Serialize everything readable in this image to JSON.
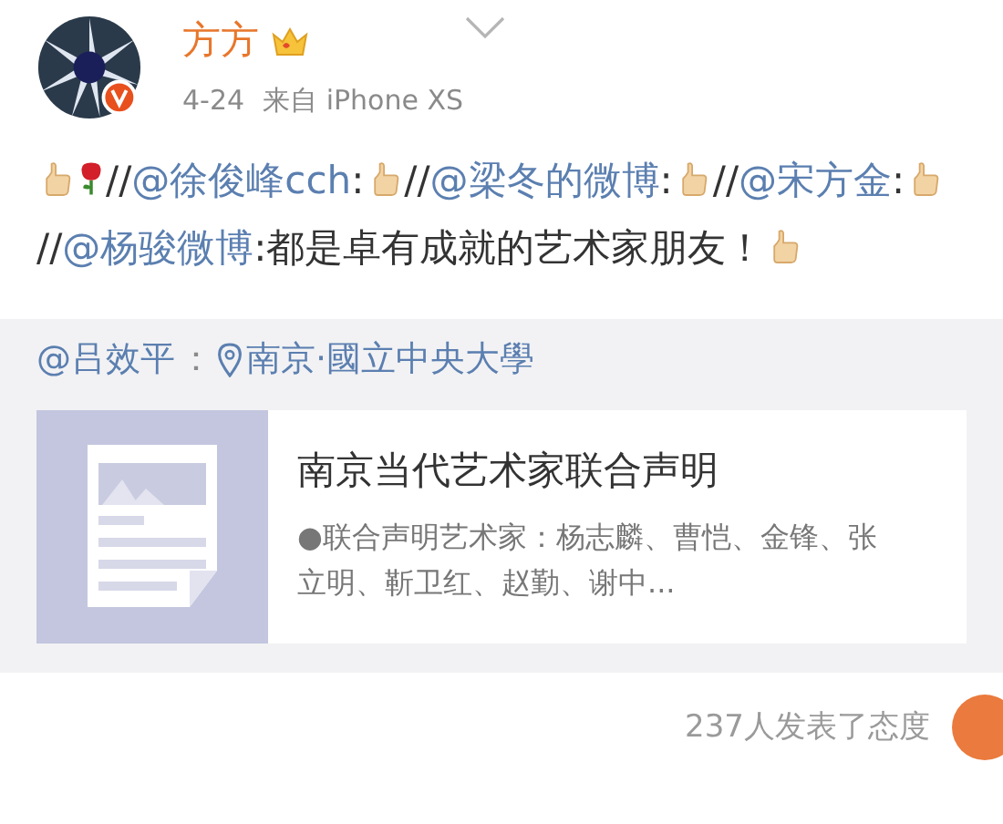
{
  "post": {
    "author": "方方",
    "time": "4-24",
    "source": "来自 iPhone XS",
    "body": [
      {
        "kind": "thumb"
      },
      {
        "kind": "rose"
      },
      {
        "kind": "text",
        "text": "//"
      },
      {
        "kind": "mention",
        "text": "@徐俊峰cch"
      },
      {
        "kind": "text",
        "text": ":"
      },
      {
        "kind": "thumb"
      },
      {
        "kind": "text",
        "text": "//"
      },
      {
        "kind": "mention",
        "text": "@梁冬的微博"
      },
      {
        "kind": "text",
        "text": ":"
      },
      {
        "kind": "thumb"
      },
      {
        "kind": "text",
        "text": "//"
      },
      {
        "kind": "mention",
        "text": "@宋方金"
      },
      {
        "kind": "text",
        "text": ":"
      },
      {
        "kind": "thumb"
      },
      {
        "kind": "text",
        "text": "//"
      },
      {
        "kind": "mention",
        "text": "@杨骏微博"
      },
      {
        "kind": "text",
        "text": ":都是卓有成就的艺术家朋友！"
      },
      {
        "kind": "thumb"
      }
    ]
  },
  "repost": {
    "author": "@吕效平",
    "separator": "：",
    "location": "南京·國立中央大學",
    "card": {
      "title": "南京当代艺术家联合声明",
      "summary": "●联合声明艺术家：杨志麟、曹恺、金锋、张立明、靳卫红、赵勤、谢中..."
    }
  },
  "footer": {
    "reactions": "237人发表了态度"
  }
}
